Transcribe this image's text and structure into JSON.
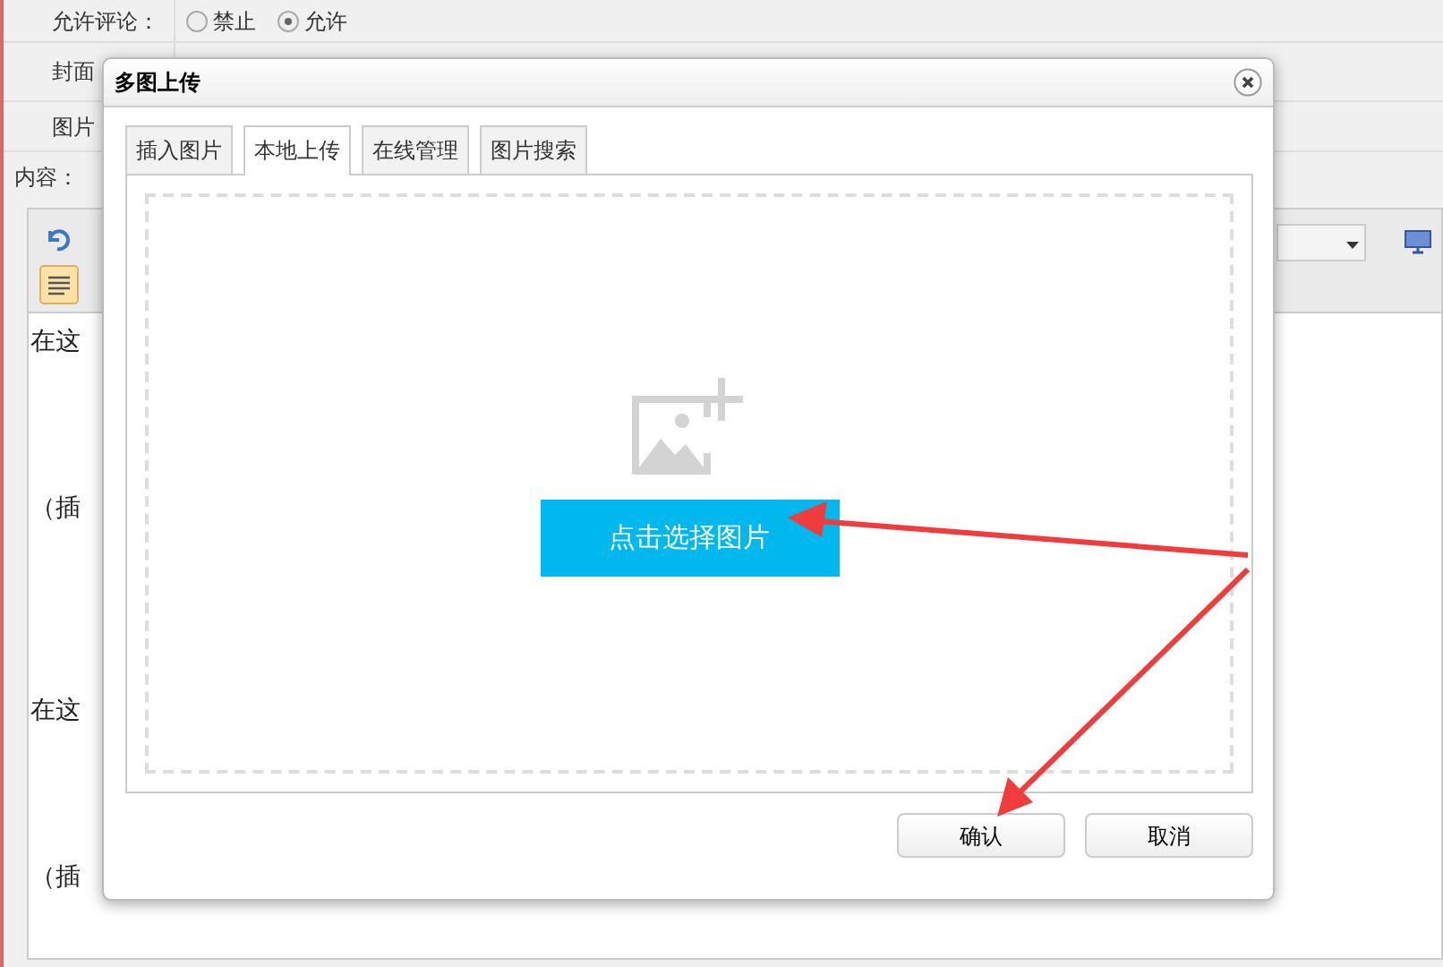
{
  "form": {
    "comment_label": "允许评论：",
    "comment_options": [
      {
        "label": "禁止",
        "selected": false
      },
      {
        "label": "允许",
        "selected": true
      }
    ],
    "rows": [
      "封面",
      "图片"
    ],
    "content_label": "内容：",
    "editor_lines": [
      "在这",
      "（插",
      "在这",
      "（插"
    ]
  },
  "dialog": {
    "title": "多图上传",
    "tabs": [
      {
        "label": "插入图片",
        "selected": false
      },
      {
        "label": "本地上传",
        "selected": true
      },
      {
        "label": "在线管理",
        "selected": false
      },
      {
        "label": "图片搜索",
        "selected": false
      }
    ],
    "upload_button": "点击选择图片",
    "buttons": [
      "确认",
      "取消"
    ]
  }
}
